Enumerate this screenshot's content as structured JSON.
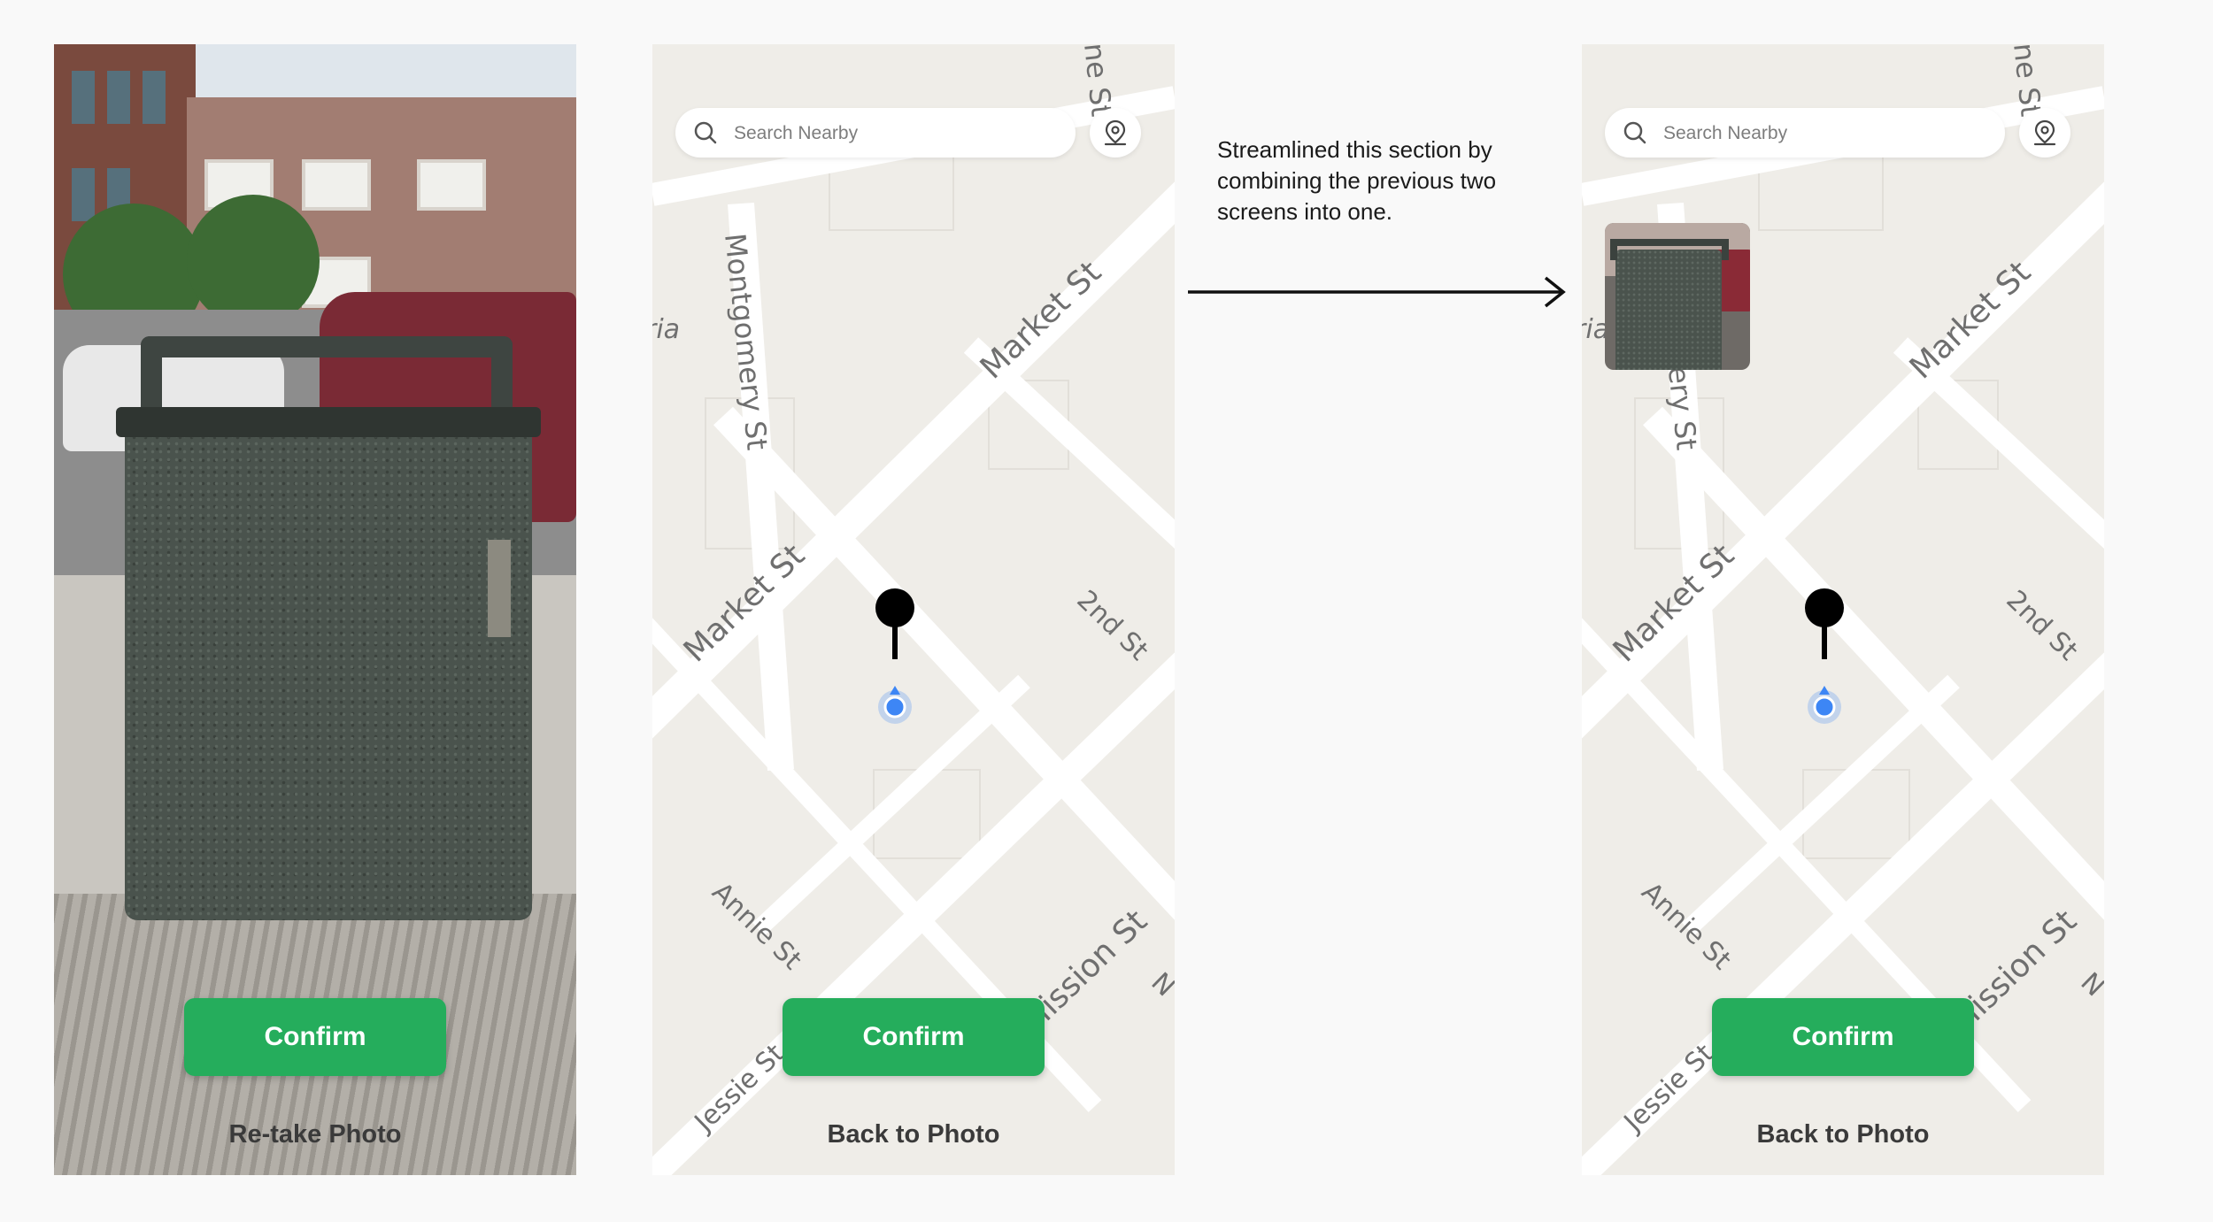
{
  "screens": [
    {
      "id": "photo",
      "confirm_label": "Confirm",
      "secondary_label": "Re-take Photo"
    },
    {
      "id": "map",
      "search_placeholder": "Search Nearby",
      "confirm_label": "Confirm",
      "secondary_label": "Back to Photo"
    },
    {
      "id": "combined",
      "search_placeholder": "Search Nearby",
      "confirm_label": "Confirm",
      "secondary_label": "Back to Photo"
    }
  ],
  "map_labels": {
    "montgomery": "Montgomery St",
    "market_upper": "Market St",
    "market_lower": "Market St",
    "second": "2nd St",
    "annie": "Annie St",
    "jessie": "Jessie St",
    "mission": "Mission St",
    "top_street": "ne St",
    "ria": "ria",
    "n": "N"
  },
  "annotation": {
    "lines": [
      "Streamlined this section by",
      "combining the previous two",
      "screens into one."
    ]
  },
  "colors": {
    "confirm": "#25ad5c",
    "map_background": "#efede8",
    "road": "#ffffff",
    "user_location": "#3d86f5",
    "pin": "#000000"
  },
  "icons": [
    "search-icon",
    "location-pin-icon",
    "map-pin-icon",
    "user-location-icon",
    "arrow-right-icon"
  ]
}
